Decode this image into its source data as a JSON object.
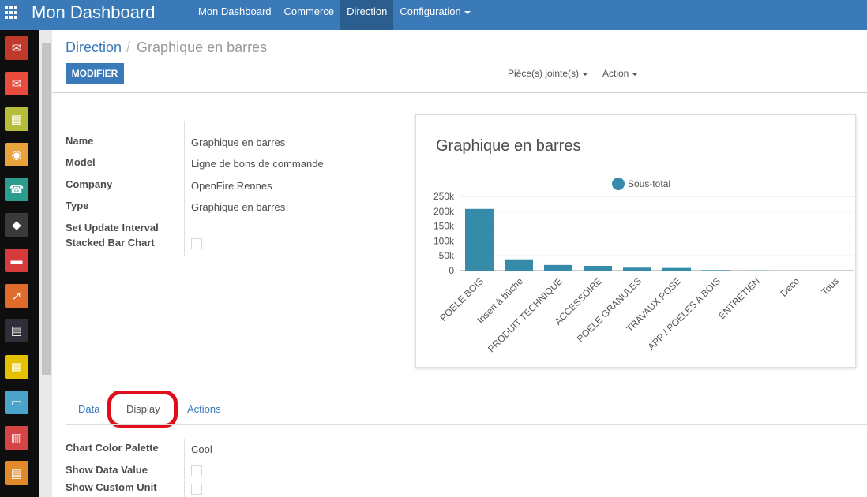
{
  "app": {
    "title": "Mon Dashboard"
  },
  "topmenu": {
    "items": [
      {
        "label": "Mon Dashboard"
      },
      {
        "label": "Commerce"
      },
      {
        "label": "Direction"
      },
      {
        "label": "Configuration"
      }
    ]
  },
  "leftbar": {
    "apps": [
      {
        "icon": "chat-icon",
        "color": "#c0392b",
        "glyph": "✉"
      },
      {
        "icon": "mail-icon",
        "color": "#e74c3c",
        "glyph": "✉"
      },
      {
        "icon": "calendar-icon",
        "color": "#b5bd3a",
        "glyph": "▦"
      },
      {
        "icon": "map-pin-icon",
        "color": "#e8a33c",
        "glyph": "◉"
      },
      {
        "icon": "contacts-icon",
        "color": "#2a9d8f",
        "glyph": "☎"
      },
      {
        "icon": "box-icon",
        "color": "#3a3a3a",
        "glyph": "◆"
      },
      {
        "icon": "folder-icon",
        "color": "#d63a3a",
        "glyph": "▬"
      },
      {
        "icon": "chart-icon",
        "color": "#e06c2c",
        "glyph": "↗"
      },
      {
        "icon": "document-icon",
        "color": "#2f2f3a",
        "glyph": "▤"
      },
      {
        "icon": "calculator-icon",
        "color": "#e5c000",
        "glyph": "▦"
      },
      {
        "icon": "card-icon",
        "color": "#4aa3c9",
        "glyph": "▭"
      },
      {
        "icon": "building-icon",
        "color": "#d64545",
        "glyph": "▥"
      },
      {
        "icon": "file-icon",
        "color": "#e08a2c",
        "glyph": "▤"
      }
    ]
  },
  "breadcrumb": {
    "parent": "Direction",
    "separator": "/",
    "current": "Graphique en barres"
  },
  "toolbar": {
    "modifier_label": "MODIFIER",
    "attachments_label": "Pièce(s) jointe(s)",
    "action_label": "Action"
  },
  "form": {
    "fields": [
      {
        "label": "Name",
        "value": "Graphique en barres"
      },
      {
        "label": "Model",
        "value": "Ligne de bons de commande"
      },
      {
        "label": "Company",
        "value": "OpenFire Rennes"
      },
      {
        "label": "Type",
        "value": "Graphique en barres"
      },
      {
        "label": "Set Update Interval",
        "value": ""
      },
      {
        "label": "Stacked Bar Chart",
        "value": ""
      }
    ]
  },
  "tabs": [
    {
      "label": "Data"
    },
    {
      "label": "Display"
    },
    {
      "label": "Actions"
    }
  ],
  "display_fields": [
    {
      "label": "Chart Color Palette",
      "value": "Cool"
    },
    {
      "label": "Show Data Value",
      "value": ""
    },
    {
      "label": "Show Custom Unit",
      "value": ""
    }
  ],
  "chart_data": {
    "type": "bar",
    "title": "Graphique en barres",
    "series": [
      {
        "name": "Sous-total",
        "values": [
          208000,
          38000,
          19000,
          16000,
          10000,
          9000,
          2000,
          500,
          0,
          0
        ]
      }
    ],
    "categories": [
      "POELE BOIS",
      "Insert à bûche",
      "PRODUIT TECHNIQUE",
      "ACCESSOIRE",
      "POELE GRANULES",
      "TRAVAUX POSE",
      "APP / POELES A BOIS",
      "ENTRETIEN",
      "Deco",
      "Tous"
    ],
    "yticks": [
      "0",
      "50k",
      "100k",
      "150k",
      "200k",
      "250k"
    ],
    "ylim": [
      0,
      250000
    ],
    "color": "#368bab",
    "legend": "top"
  }
}
